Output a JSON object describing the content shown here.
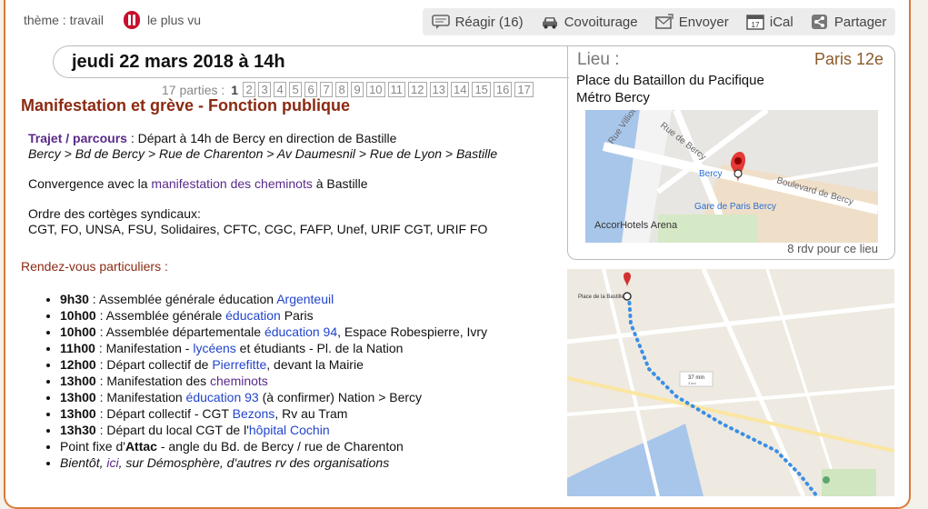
{
  "topbar": {
    "theme": "thème : travail",
    "most_viewed": "le plus vu"
  },
  "actions": [
    {
      "id": "reagir",
      "label": "Réagir (16)",
      "icon": "speech-bubble-icon"
    },
    {
      "id": "covoiturage",
      "label": "Covoiturage",
      "icon": "car-icon"
    },
    {
      "id": "envoyer",
      "label": "Envoyer",
      "icon": "envelope-icon"
    },
    {
      "id": "ical",
      "label": "iCal",
      "icon": "calendar-icon"
    },
    {
      "id": "partager",
      "label": "Partager",
      "icon": "share-icon"
    }
  ],
  "event": {
    "date": "jeudi 22 mars 2018 à 14h",
    "title": "Manifestation et grève - Fonction publique"
  },
  "pager": {
    "label": "17 parties :",
    "current": "1",
    "pages": [
      "2",
      "3",
      "4",
      "5",
      "6",
      "7",
      "8",
      "9",
      "10",
      "11",
      "12",
      "13",
      "14",
      "15",
      "16",
      "17"
    ]
  },
  "description": {
    "route_label": "Trajet / parcours",
    "route_text": " : Départ à 14h de Bercy en direction de Bastille",
    "route_path": "Bercy > Bd de Bercy > Rue de Charenton > Av Daumesnil > Rue de Lyon > Bastille",
    "convergence_pre": "Convergence avec la ",
    "convergence_link": "manifestation des cheminots",
    "convergence_post": " à Bastille",
    "order_label": "Ordre des cortèges syndicaux:",
    "order_text": "CGT, FO, UNSA, FSU, Solidaires, CFTC, CGC, FAFP, Unef, URIF CGT, URIF FO"
  },
  "rdv": {
    "title": "Rendez-vous particuliers :",
    "items": [
      {
        "time": "9h30",
        "pre": " : Assemblée générale éducation ",
        "link": "Argenteuil",
        "post": ""
      },
      {
        "time": "10h00",
        "pre": " : Assemblée générale ",
        "link": "éducation",
        "post": " Paris"
      },
      {
        "time": "10h00",
        "pre": " : Assemblée départementale ",
        "link": "éducation 94",
        "post": ", Espace Robespierre, Ivry"
      },
      {
        "time": "11h00",
        "pre": " : Manifestation - ",
        "link": "lycéens",
        "post": " et étudiants - Pl. de la Nation"
      },
      {
        "time": "12h00",
        "pre": " : Départ collectif de ",
        "link": "Pierrefitte",
        "post": ", devant la Mairie"
      },
      {
        "time": "13h00",
        "pre": " : Manifestation des ",
        "link": "cheminots",
        "post": ""
      },
      {
        "time": "13h00",
        "pre": " : Manifestation ",
        "link": "éducation 93",
        "post": " (à confirmer) Nation > Bercy"
      },
      {
        "time": "13h00",
        "pre": " : Départ collectif - CGT ",
        "link": "Bezons",
        "post": ", Rv au Tram"
      },
      {
        "time": "13h30",
        "pre": " : Départ du local CGT de l'",
        "link": "hôpital Cochin",
        "post": ""
      }
    ],
    "attac_pre": "Point fixe d'",
    "attac_bold": "Attac",
    "attac_post": " - angle du Bd. de Bercy / rue de Charenton",
    "soon_pre": "Bientôt, ",
    "soon_link": "ici",
    "soon_post": ", sur Démosphère, d'autres rv des organisations"
  },
  "lieu": {
    "heading": "Lieu :",
    "city": "Paris 12e",
    "address_line1": "Place du Bataillon du Pacifique",
    "address_line2": "Métro Bercy",
    "count": "8 rdv pour ce lieu",
    "map_labels": {
      "rue_villiot": "Rue Villiot",
      "rue_de_bercy": "Rue de Bercy",
      "bercy": "Bercy",
      "boulevard": "Boulevard de Bercy",
      "gare": "Gare de Paris Bercy",
      "arena": "AccorHotels Arena"
    }
  },
  "route_map": {
    "start": "Place de la Bastille",
    "duration": "37 min",
    "distance": "3 km"
  }
}
